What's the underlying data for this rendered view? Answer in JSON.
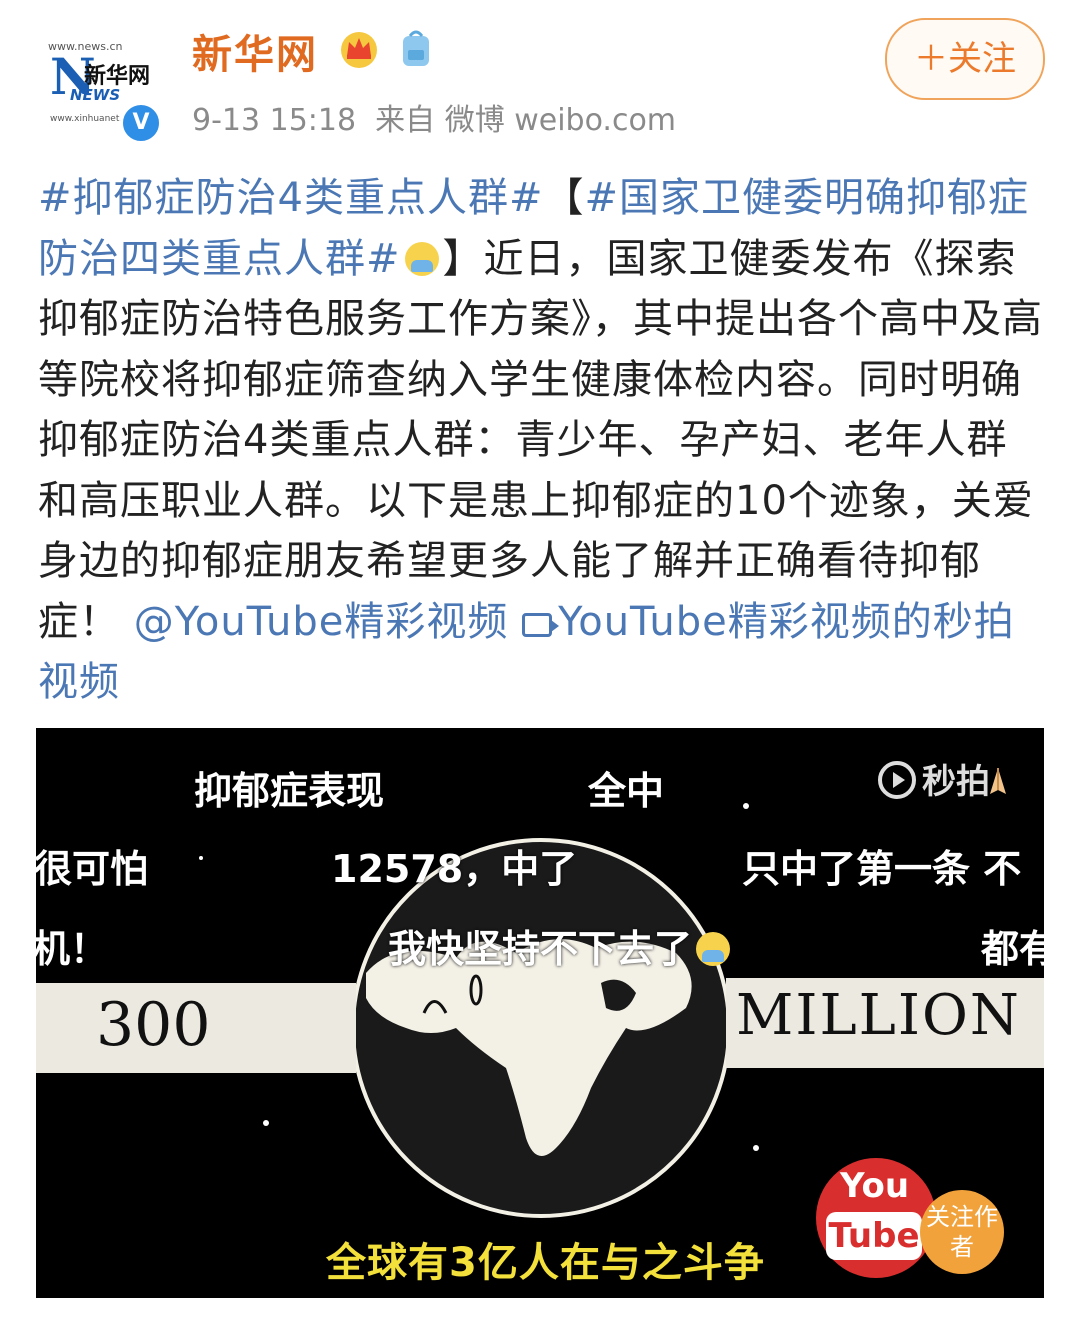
{
  "user": {
    "avatar_url_text": "www.news.cn",
    "avatar_brand": "新华网",
    "avatar_news": "NEWS",
    "avatar_small": "www.xinhuanet.com",
    "verified_mark": "V",
    "name": "新华网",
    "time": "9-13 15:18",
    "source": "来自 微博 weibo.com",
    "icons": [
      "crown-icon",
      "backpack-icon"
    ]
  },
  "follow_button": "＋关注",
  "post": {
    "hashtag1": "#抑郁症防治4类重点人群#",
    "bracket_open": "【",
    "hashtag2": "#国家卫健委明确抑郁症防治四类重点人群#",
    "bracket_close": "】",
    "body": "近日，国家卫健委发布《探索抑郁症防治特色服务工作方案》，其中提出各个高中及高等院校将抑郁症筛查纳入学生健康体检内容。同时明确抑郁症防治4类重点人群：青少年、孕产妇、老年人群和高压职业人群。以下是患上抑郁症的10个迹象，关爱身边的抑郁症朋友希望更多人能了解并正确看待抑郁症！",
    "mention": "@YouTube精彩视频",
    "video_link": "YouTube精彩视频的秒拍视频"
  },
  "video": {
    "watermark": "秒拍",
    "danmu": [
      "抑郁症表现",
      "全中",
      "很可怕",
      "12578，中了",
      "只中了第一条 不",
      "机！",
      "我快坚持不下去了",
      "都有"
    ],
    "banner_left": "300",
    "banner_right": "MILLION",
    "caption": "全球有3亿人在与之斗争",
    "yt_you": "You",
    "yt_tube": "Tube",
    "follow_author": "关注作者"
  },
  "colors": {
    "username": "#e06a1f",
    "link": "#4b78b4",
    "follow_border": "#f0a35a",
    "caption": "#f4e03a",
    "youtube_red": "#d92e2e"
  }
}
